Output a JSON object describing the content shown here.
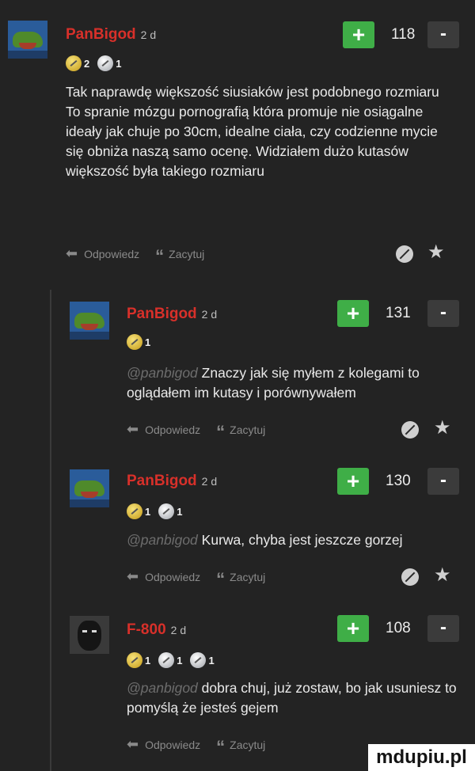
{
  "comments": [
    {
      "username": "PanBigod",
      "age": "2 d",
      "score": "118",
      "badges": [
        {
          "type": "gold",
          "count": "2"
        },
        {
          "type": "silver",
          "count": "1"
        }
      ],
      "mention": "",
      "text": "Tak naprawdę większość siusiaków jest podobnego rozmiaru\nTo spranie mózgu pornografią która promuje nie osiągalne ideały jak chuje po 30cm, idealne ciała, czy codzienne mycie się obniża naszą samo ocenę. Widziałem dużo kutasów większość była takiego rozmiaru"
    },
    {
      "username": "PanBigod",
      "age": "2 d",
      "score": "131",
      "badges": [
        {
          "type": "gold",
          "count": "1"
        }
      ],
      "mention": "@panbigod",
      "text": "Znaczy jak się myłem z kolegami to oglądałem im kutasy i porównywałem"
    },
    {
      "username": "PanBigod",
      "age": "2 d",
      "score": "130",
      "badges": [
        {
          "type": "gold",
          "count": "1"
        },
        {
          "type": "silver",
          "count": "1"
        }
      ],
      "mention": "@panbigod",
      "text": "Kurwa, chyba jest jeszcze gorzej"
    },
    {
      "username": "F-800",
      "age": "2 d",
      "score": "108",
      "badges": [
        {
          "type": "gold",
          "count": "1"
        },
        {
          "type": "silver",
          "count": "1"
        },
        {
          "type": "silver",
          "count": "1"
        }
      ],
      "mention": "@panbigod",
      "text": "dobra chuj, już zostaw, bo jak usuniesz to pomyślą że jesteś gejem"
    }
  ],
  "actions": {
    "reply": "Odpowiedz",
    "quote": "Zacytuj"
  },
  "vote": {
    "plus": "+",
    "minus": "-"
  },
  "icons": {
    "reply": "reply-arrow-icon",
    "quote": "quote-icon",
    "hide": "eye-off-icon",
    "favorite": "star-icon"
  },
  "colors": {
    "background": "#232323",
    "username": "#d8302a",
    "upvote": "#3fae47",
    "mention": "#6d6d6d"
  },
  "watermark": "mdupiu.pl"
}
